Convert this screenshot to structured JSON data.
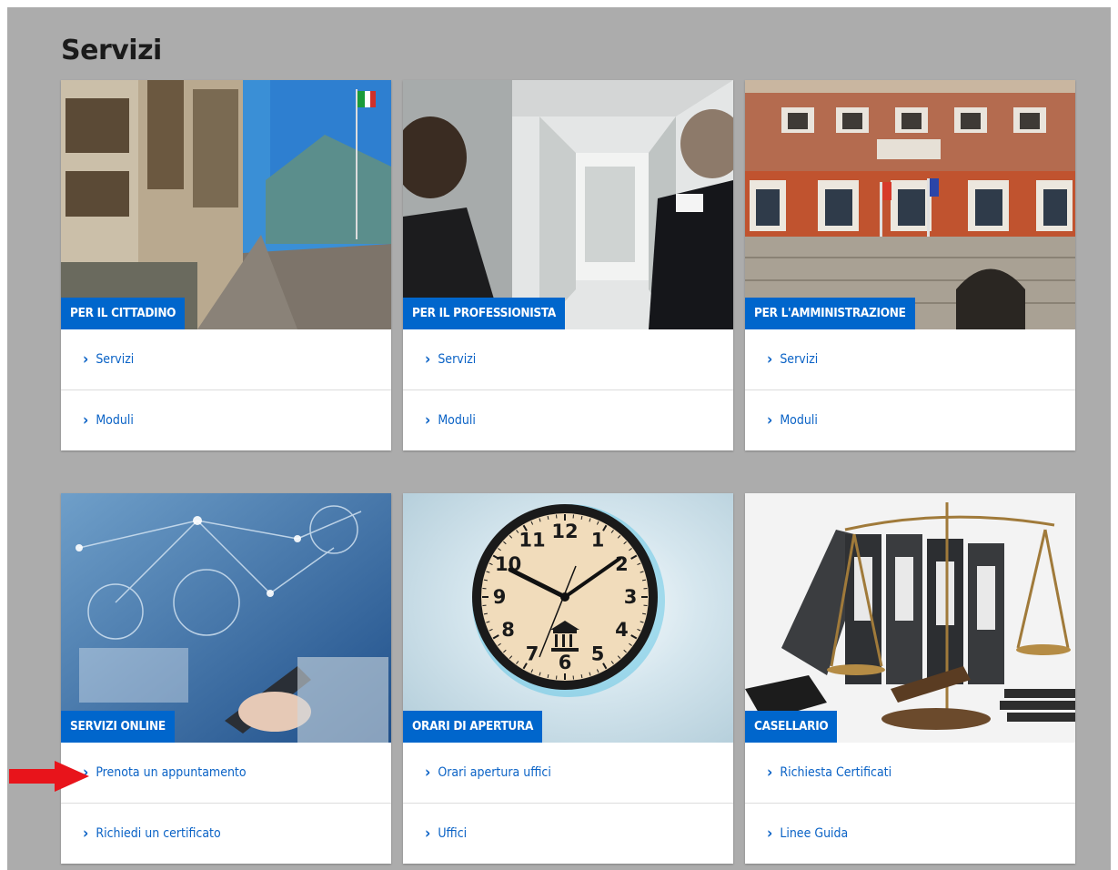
{
  "page_title": "Servizi",
  "colors": {
    "accent": "#0066cc",
    "link": "#0b63c6",
    "background": "#acacac",
    "pointer_arrow": "#e8141b"
  },
  "cards": [
    {
      "label": "PER IL CITTADINO",
      "links": [
        "Servizi",
        "Moduli"
      ]
    },
    {
      "label": "PER IL PROFESSIONISTA",
      "links": [
        "Servizi",
        "Moduli"
      ]
    },
    {
      "label": "PER L'AMMINISTRAZIONE",
      "links": [
        "Servizi",
        "Moduli"
      ]
    },
    {
      "label": "SERVIZI ONLINE",
      "links": [
        "Prenota un appuntamento",
        "Richiedi un certificato"
      ]
    },
    {
      "label": "ORARI DI APERTURA",
      "links": [
        "Orari apertura uffici",
        "Uffici"
      ]
    },
    {
      "label": "CASELLARIO",
      "links": [
        "Richiesta Certificati",
        "Linee Guida"
      ]
    }
  ],
  "clock_numerals": [
    "12",
    "1",
    "2",
    "3",
    "4",
    "5",
    "6",
    "7",
    "8",
    "9",
    "10",
    "11"
  ],
  "icons": {
    "link_chevron": "chevron-right-icon",
    "pointer": "red-arrow-icon"
  }
}
